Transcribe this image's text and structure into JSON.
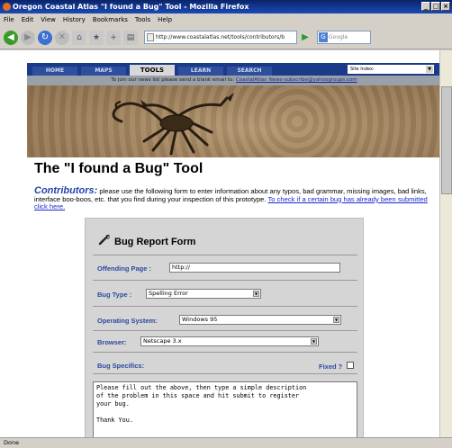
{
  "window": {
    "title": "Oregon Coastal Atlas \"I found a Bug\" Tool - Mozilla Firefox"
  },
  "menu": {
    "items": [
      "File",
      "Edit",
      "View",
      "History",
      "Bookmarks",
      "Tools",
      "Help"
    ]
  },
  "toolbar": {
    "url": "http://www.coastalatlas.net/tools/contributors/b",
    "search_placeholder": "Google"
  },
  "site": {
    "tabs": [
      "HOME",
      "MAPS",
      "TOOLS",
      "LEARN",
      "SEARCH"
    ],
    "active_tab": "TOOLS",
    "site_index": "Site Index:",
    "news_prefix": "To join our news list please send a blank email to:",
    "news_email": "CoastalAtlas_News-subscribe@yahoogroups.com"
  },
  "page": {
    "heading": "The \"I found a Bug\" Tool",
    "intro_lead": "Contributors:",
    "intro_text": " please use the following form to enter information about any typos, bad grammar, missing images, bad links, interface boo-boos, etc. that you find during your inspection of this prototype. ",
    "intro_link": "To check if a certain bug has already been submitted click here."
  },
  "form": {
    "title": "Bug Report Form",
    "offending_page_label": "Offending Page :",
    "offending_page_value": "http://",
    "bug_type_label": "Bug Type :",
    "bug_type_value": "Spelling Error",
    "os_label": "Operating System:",
    "os_value": "Windows 95",
    "browser_label": "Browser:",
    "browser_value": "Netscape 3.x",
    "specifics_label": "Bug Specifics:",
    "fixed_label": "Fixed ?",
    "specifics_text": "Please fill out the above, then type a simple description\nof the problem in this space and hit submit to register\nyour bug.\n\nThank You."
  },
  "status": {
    "text": "Done"
  }
}
